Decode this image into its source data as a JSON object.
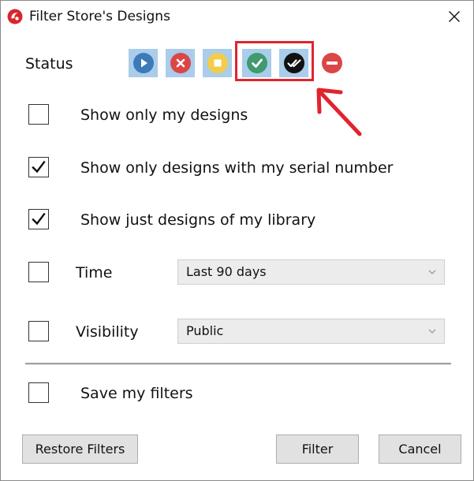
{
  "window": {
    "title": "Filter Store's Designs",
    "app_icon": "app-logo-icon",
    "close_icon": "close-icon"
  },
  "status": {
    "label": "Status",
    "buttons": [
      {
        "icon": "play-circle-icon",
        "color": "#3d7ab8",
        "selected": true
      },
      {
        "icon": "cancel-circle-icon",
        "color": "#db4646",
        "selected": true
      },
      {
        "icon": "stop-circle-icon",
        "color": "#f2cd4b",
        "selected": true
      },
      {
        "icon": "check-circle-icon",
        "color": "#3f9a6e",
        "selected": true
      },
      {
        "icon": "double-check-circle-icon",
        "color": "#111111",
        "selected": true
      },
      {
        "icon": "minus-circle-icon",
        "color": "#db4646",
        "selected": false
      }
    ]
  },
  "annotation": {
    "highlight_color": "#e0242e"
  },
  "options": {
    "my_designs": {
      "label": "Show only my designs",
      "checked": false
    },
    "serial_number": {
      "label": "Show only designs with my serial number",
      "checked": true
    },
    "library": {
      "label": "Show just designs of my library",
      "checked": true
    },
    "time": {
      "label": "Time",
      "checked": false,
      "value": "Last 90 days"
    },
    "visibility": {
      "label": "Visibility",
      "checked": false,
      "value": "Public"
    },
    "save_filters": {
      "label": "Save my filters",
      "checked": false
    }
  },
  "buttons": {
    "restore": "Restore Filters",
    "filter": "Filter",
    "cancel": "Cancel"
  }
}
